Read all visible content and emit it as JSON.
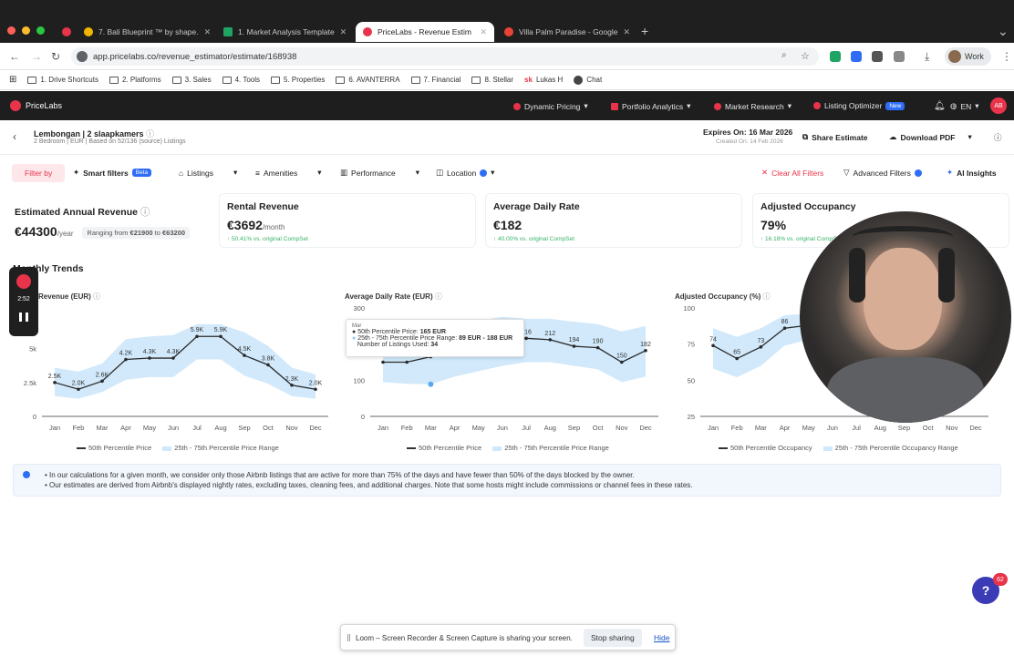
{
  "browser": {
    "tabs": [
      {
        "label": "7. Bali Blueprint ™ by shape.",
        "icon": "drive-icon",
        "color": "#f2b600"
      },
      {
        "label": "1. Market Analysis Template",
        "icon": "sheets-icon",
        "color": "#1fa463"
      },
      {
        "label": "PriceLabs - Revenue Estim",
        "icon": "pricelabs-icon",
        "color": "#e8334a"
      },
      {
        "label": "Villa Palm Paradise - Google",
        "icon": "maps-icon",
        "color": "#ea4335"
      }
    ],
    "url": "app.pricelabs.co/revenue_estimator/estimate/168938",
    "profile_label": "Work",
    "bookmarks": [
      "1. Drive Shortcuts",
      "2. Platforms",
      "3. Sales",
      "4. Tools",
      "5. Properties",
      "6. AVANTERRA",
      "7. Financial",
      "8. Stellar",
      "Lukas H",
      "Chat"
    ]
  },
  "app": {
    "brand": "PriceLabs",
    "nav": [
      "Dynamic Pricing",
      "Portfolio Analytics",
      "Market Research",
      "Listing Optimizer"
    ],
    "new_badge": "New",
    "language": "EN",
    "avatar_initials": "AB",
    "brand_color": "#e8334a"
  },
  "listing": {
    "title": "Lembongan | 2 slaapkamers",
    "subtitle": "2 Bedroom | EUR | Based on 52/136 (source) Listings",
    "expires": "Expires On: 16 Mar 2026",
    "created": "Created On: 14 Feb 2026",
    "share": "Share Estimate",
    "download": "Download PDF"
  },
  "filters": {
    "filter_by": "Filter by",
    "smart": "Smart filters",
    "beta": "Beta",
    "listings": "Listings",
    "amenities": "Amenities",
    "performance": "Performance",
    "location": "Location",
    "clear": "Clear All Filters",
    "advanced": "Advanced Filters",
    "ai": "AI Insights"
  },
  "kpis": {
    "annual": {
      "title": "Estimated Annual Revenue",
      "value": "€44300",
      "unit": "/year",
      "range_prefix": "Ranging from",
      "range_low": "€21900",
      "range_to": "to",
      "range_high": "€63200"
    },
    "rental": {
      "title": "Rental Revenue",
      "value": "€3692",
      "unit": "/month",
      "delta": "↑ 50.41% vs. original CompSet"
    },
    "adr": {
      "title": "Average Daily Rate",
      "value": "€182",
      "delta": "↑ 40.00% vs. original CompSet"
    },
    "occ": {
      "title": "Adjusted Occupancy",
      "value": "79%",
      "delta": "↑ 16.18% vs. original CompSet"
    }
  },
  "section_title": "Monthly Trends",
  "months": [
    "Jan",
    "Feb",
    "Mar",
    "Apr",
    "May",
    "Jun",
    "Jul",
    "Aug",
    "Sep",
    "Oct",
    "Nov",
    "Dec"
  ],
  "chart_data": [
    {
      "type": "line",
      "title": "Revenue (EUR)",
      "x": [
        "Jan",
        "Feb",
        "Mar",
        "Apr",
        "May",
        "Jun",
        "Jul",
        "Aug",
        "Sep",
        "Oct",
        "Nov",
        "Dec"
      ],
      "yticks": [
        "0",
        "2.5k",
        "5k"
      ],
      "ylim": [
        0,
        8000
      ],
      "series": [
        {
          "name": "50th Percentile Price",
          "values": [
            2500,
            2000,
            2600,
            4200,
            4300,
            4300,
            5900,
            5900,
            4500,
            3800,
            2300,
            2000
          ],
          "labels": [
            "2.5K",
            "2.0K",
            "2.6K",
            "4.2K",
            "4.3K",
            "4.3K",
            "5.9K",
            "5.9K",
            "4.5K",
            "3.8K",
            "2.3K",
            "2.0K"
          ]
        },
        {
          "name": "25th - 75th Percentile Price Range",
          "low": [
            1500,
            1300,
            1800,
            2700,
            2900,
            2900,
            4200,
            4200,
            3000,
            2400,
            1500,
            1300
          ],
          "high": [
            3600,
            3300,
            3900,
            5700,
            5900,
            6000,
            6800,
            6800,
            6200,
            5200,
            3600,
            3100
          ]
        }
      ]
    },
    {
      "type": "line",
      "title": "Average Daily Rate (EUR)",
      "x": [
        "Jan",
        "Feb",
        "Mar",
        "Apr",
        "May",
        "Jun",
        "Jul",
        "Aug",
        "Sep",
        "Oct",
        "Nov",
        "Dec"
      ],
      "yticks": [
        "0",
        "100",
        "300"
      ],
      "ylim": [
        0,
        300
      ],
      "series": [
        {
          "name": "50th Percentile Price",
          "values": [
            150,
            150,
            165,
            190,
            205,
            214,
            216,
            212,
            194,
            190,
            150,
            182
          ],
          "labels": [
            "",
            "",
            "",
            "",
            "",
            "",
            "216",
            "212",
            "194",
            "190",
            "150",
            "182"
          ]
        },
        {
          "name": "25th - 75th Percentile Price Range",
          "low": [
            95,
            90,
            89,
            110,
            125,
            140,
            150,
            150,
            140,
            130,
            95,
            110
          ],
          "high": [
            240,
            245,
            188,
            245,
            265,
            275,
            270,
            270,
            262,
            255,
            235,
            250
          ]
        }
      ],
      "tooltip": {
        "month": "Mar",
        "median_label": "50th Percentile Price:",
        "median_value": "165 EUR",
        "range_label": "25th - 75th Percentile Price Range:",
        "range_value": "89 EUR - 188 EUR",
        "count_label": "Number of Listings Used:",
        "count_value": "34"
      }
    },
    {
      "type": "line",
      "title": "Adjusted Occupancy (%)",
      "x": [
        "Jan",
        "Feb",
        "Mar",
        "Apr",
        "May",
        "Jun",
        "Jul",
        "Aug",
        "Sep",
        "Oct",
        "Nov",
        "Dec"
      ],
      "yticks": [
        "25",
        "50",
        "75",
        "100"
      ],
      "ylim": [
        25,
        100
      ],
      "series": [
        {
          "name": "50th Percentile Occupancy",
          "values": [
            74,
            65,
            73,
            86,
            88,
            90,
            92,
            92,
            90,
            80,
            70,
            60
          ],
          "labels": [
            "74",
            "65",
            "73",
            "86",
            "",
            "",
            "",
            "",
            "",
            "",
            "",
            ""
          ]
        },
        {
          "name": "25th - 75th Percentile Occupancy Range",
          "low": [
            58,
            52,
            60,
            74,
            78,
            80,
            82,
            82,
            78,
            68,
            56,
            48
          ],
          "high": [
            86,
            80,
            86,
            95,
            96,
            97,
            98,
            98,
            96,
            90,
            82,
            74
          ]
        }
      ]
    }
  ],
  "info": {
    "line1": "In our calculations for a given month, we consider only those Airbnb listings that are active for more than 75% of the days and have fewer than 50% of the days blocked by the owner.",
    "line2": "Our estimates are derived from Airbnb's displayed nightly rates, excluding taxes, cleaning fees, and additional charges. Note that some hosts might include commissions or channel fees in these rates."
  },
  "recorder": {
    "time": "2:52"
  },
  "help_badge": "62",
  "loom": {
    "text": "Loom – Screen Recorder & Screen Capture is sharing your screen.",
    "stop": "Stop sharing",
    "hide": "Hide"
  }
}
